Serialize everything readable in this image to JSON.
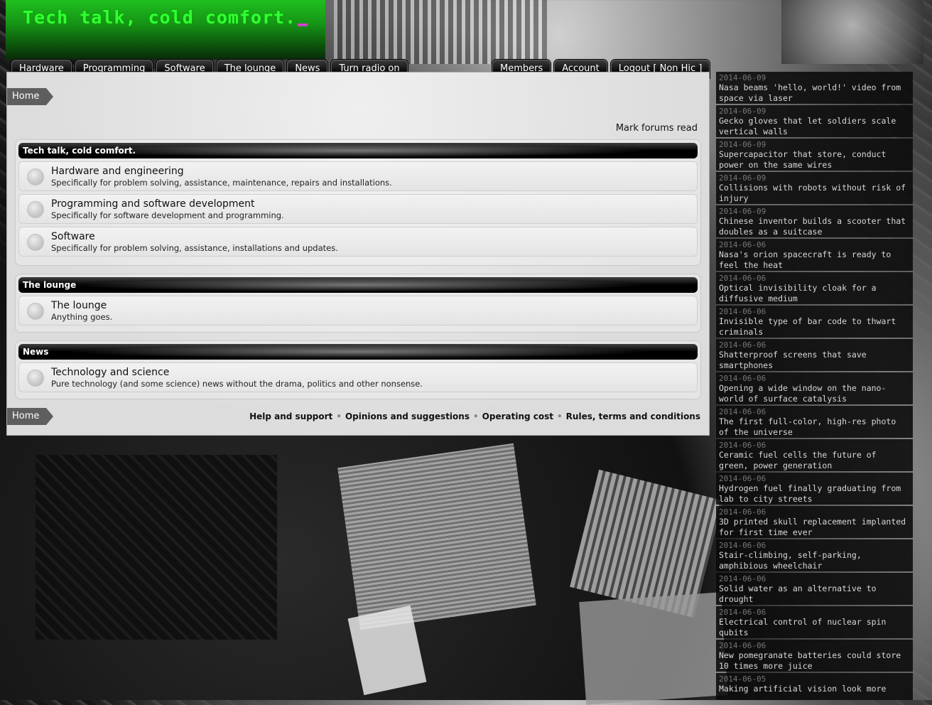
{
  "site": {
    "title": "Tech talk, cold comfort."
  },
  "nav_left": [
    "Hardware",
    "Programming",
    "Software",
    "The lounge",
    "News",
    "Turn radio on"
  ],
  "nav_right": [
    "Members",
    "Account",
    "Logout [ Non Hic ]"
  ],
  "breadcrumb": {
    "home": "Home"
  },
  "mark_forums_read": "Mark forums read",
  "categories": [
    {
      "name": "Tech talk, cold comfort.",
      "forums": [
        {
          "title": "Hardware and engineering",
          "desc": "Specifically for problem solving, assistance, maintenance, repairs and installations."
        },
        {
          "title": "Programming and software development",
          "desc": "Specifically for software development and programming."
        },
        {
          "title": "Software",
          "desc": "Specifically for problem solving, assistance, installations and updates."
        }
      ]
    },
    {
      "name": "The lounge",
      "forums": [
        {
          "title": "The lounge",
          "desc": "Anything goes."
        }
      ]
    },
    {
      "name": "News",
      "forums": [
        {
          "title": "Technology and science",
          "desc": "Pure technology (and some science) news without the drama, politics and other nonsense."
        }
      ]
    }
  ],
  "footer_links": [
    "Help and support",
    "Opinions and suggestions",
    "Operating cost",
    "Rules, terms and conditions"
  ],
  "news": [
    {
      "date": "2014-06-09",
      "title": "Nasa beams 'hello, world!' video from space via laser"
    },
    {
      "date": "2014-06-09",
      "title": "Gecko gloves that let soldiers scale vertical walls"
    },
    {
      "date": "2014-06-09",
      "title": "Supercapacitor that store, conduct power on the same wires"
    },
    {
      "date": "2014-06-09",
      "title": "Collisions with robots without risk of injury"
    },
    {
      "date": "2014-06-09",
      "title": "Chinese inventor builds a scooter that doubles as a suitcase"
    },
    {
      "date": "2014-06-06",
      "title": "Nasa's orion spacecraft is ready to feel the heat"
    },
    {
      "date": "2014-06-06",
      "title": "Optical invisibility cloak for a diffusive medium"
    },
    {
      "date": "2014-06-06",
      "title": "Invisible type of bar code to thwart criminals"
    },
    {
      "date": "2014-06-06",
      "title": "Shatterproof screens that save smartphones"
    },
    {
      "date": "2014-06-06",
      "title": "Opening a wide window on the nano-world of surface catalysis"
    },
    {
      "date": "2014-06-06",
      "title": "The first full-color, high-res photo of the universe"
    },
    {
      "date": "2014-06-06",
      "title": "Ceramic fuel cells the future of green, power generation"
    },
    {
      "date": "2014-06-06",
      "title": "Hydrogen fuel finally graduating from lab to city streets"
    },
    {
      "date": "2014-06-06",
      "title": "3D printed skull replacement implanted for first time ever"
    },
    {
      "date": "2014-06-06",
      "title": "Stair-climbing, self-parking, amphibious wheelchair"
    },
    {
      "date": "2014-06-06",
      "title": "Solid water as an alternative to drought"
    },
    {
      "date": "2014-06-06",
      "title": "Electrical control of nuclear spin qubits"
    },
    {
      "date": "2014-06-06",
      "title": "New pomegranate batteries could store 10 times more juice"
    },
    {
      "date": "2014-06-05",
      "title": "Making artificial vision look more"
    }
  ]
}
